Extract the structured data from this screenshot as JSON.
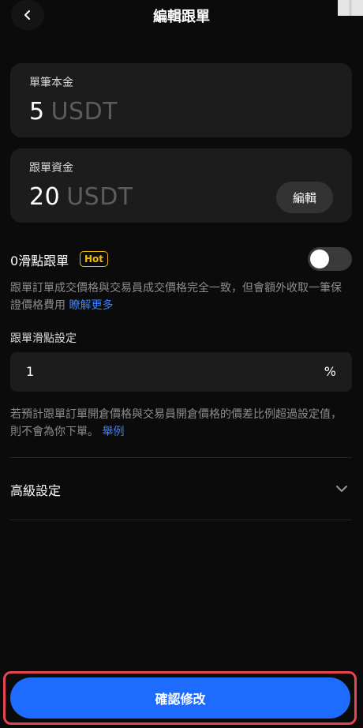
{
  "header": {
    "title": "編輯跟單"
  },
  "single_amount": {
    "label": "單筆本金",
    "value": "5",
    "unit": "USDT"
  },
  "copy_funds": {
    "label": "跟單資金",
    "value": "20",
    "unit": "USDT",
    "edit_label": "編輯"
  },
  "slippage": {
    "title": "0滑點跟單",
    "badge": "Hot",
    "toggle_on": false,
    "description": "跟單訂單成交價格與交易員成交價格完全一致，但會額外收取一筆保證價格費用",
    "learn_more": "瞭解更多"
  },
  "slippage_setting": {
    "label": "跟單滑點設定",
    "value": "1",
    "unit": "%",
    "note": "若預計跟單訂單開倉價格與交易員開倉價格的價差比例超過設定值，則不會為你下單。",
    "example_link": "舉例"
  },
  "advanced": {
    "title": "高級設定"
  },
  "confirm": {
    "label": "確認修改"
  },
  "colors": {
    "accent": "#1e6bff",
    "link": "#3b82ff",
    "hot": "#f0b90b",
    "highlight": "#e5464f"
  }
}
